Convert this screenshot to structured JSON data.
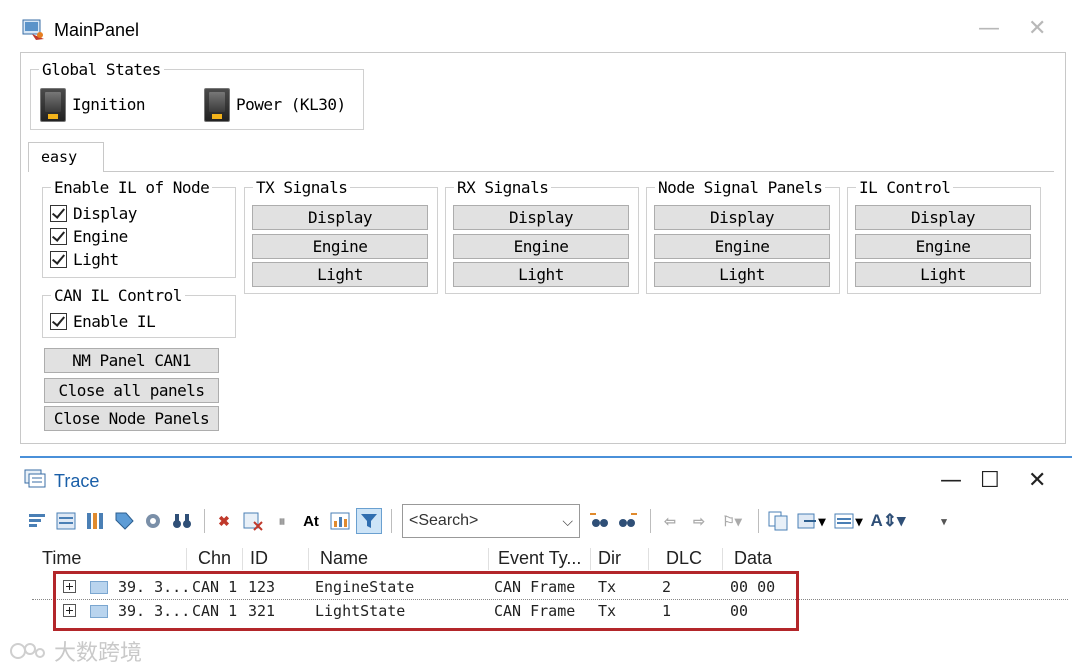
{
  "main_window": {
    "title": "MainPanel",
    "minimize": "—",
    "close": "✕"
  },
  "global_states": {
    "legend": "Global States",
    "ignition": "Ignition",
    "power": "Power (KL30)"
  },
  "tab": {
    "label": "easy"
  },
  "enable_il": {
    "legend": "Enable IL of Node",
    "items": [
      "Display",
      "Engine",
      "Light"
    ],
    "checked": [
      true,
      true,
      true
    ]
  },
  "can_il_control": {
    "legend": "CAN IL Control",
    "enable_label": "Enable IL",
    "checked": true
  },
  "buttons": {
    "nm_panel": "NM Panel CAN1",
    "close_all": "Close all panels",
    "close_node": "Close Node Panels"
  },
  "groups": [
    {
      "legend": "TX Signals",
      "buttons": [
        "Display",
        "Engine",
        "Light"
      ]
    },
    {
      "legend": "RX Signals",
      "buttons": [
        "Display",
        "Engine",
        "Light"
      ]
    },
    {
      "legend": "Node Signal Panels",
      "buttons": [
        "Display",
        "Engine",
        "Light"
      ]
    },
    {
      "legend": "IL Control",
      "buttons": [
        "Display",
        "Engine",
        "Light"
      ]
    }
  ],
  "trace_window": {
    "title": "Trace",
    "minimize": "—",
    "maximize": "☐",
    "close": "✕",
    "search_placeholder": "<Search>"
  },
  "trace_table": {
    "columns": [
      "Time",
      "Chn",
      "ID",
      "Name",
      "Event Ty...",
      "Dir",
      "DLC",
      "Data"
    ],
    "rows": [
      {
        "time": "39. 3...",
        "chn": "CAN 1",
        "id": "123",
        "name": "EngineState",
        "event": "CAN Frame",
        "dir": "Tx",
        "dlc": "2",
        "data": "00 00"
      },
      {
        "time": "39. 3...",
        "chn": "CAN 1",
        "id": "321",
        "name": "LightState",
        "event": "CAN Frame",
        "dir": "Tx",
        "dlc": "1",
        "data": "00"
      }
    ]
  },
  "watermark": "大数跨境",
  "colors": {
    "highlight": "#b3262a",
    "trace_title": "#1a5fa8",
    "switch_lamp": "#f2b31b"
  }
}
